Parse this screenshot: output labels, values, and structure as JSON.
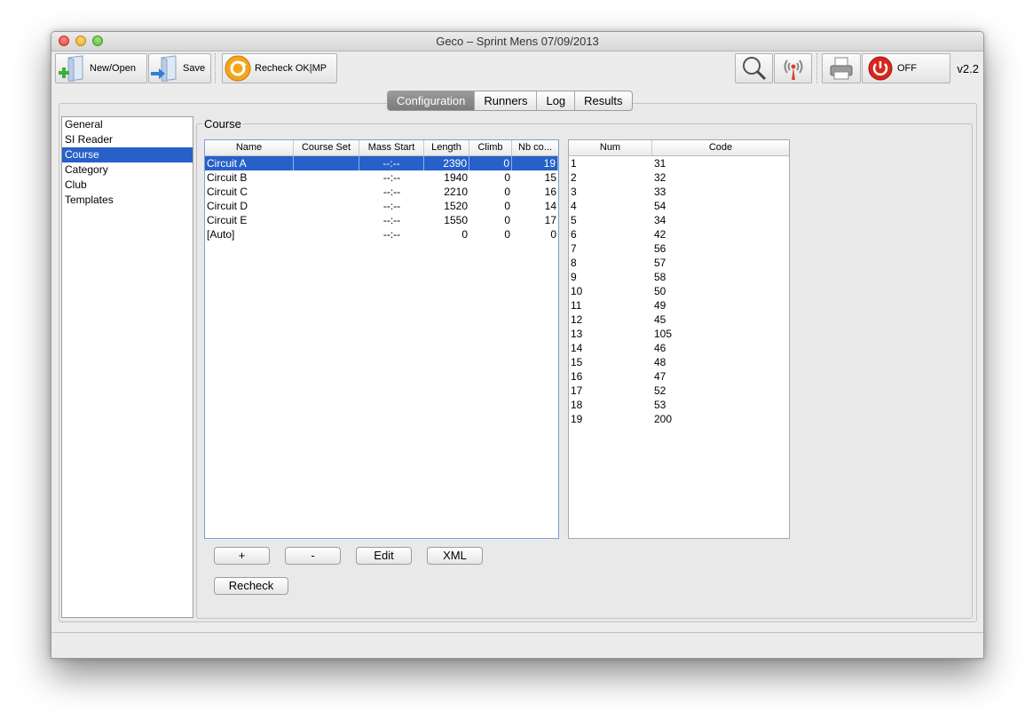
{
  "window": {
    "title": "Geco – Sprint Mens 07/09/2013"
  },
  "toolbar": {
    "new_open": "New/Open",
    "save": "Save",
    "recheck_ok_mp": "Recheck OK|MP",
    "off": "OFF",
    "version": "v2.2"
  },
  "tabs": [
    "Configuration",
    "Runners",
    "Log",
    "Results"
  ],
  "nav": [
    "General",
    "SI Reader",
    "Course",
    "Category",
    "Club",
    "Templates"
  ],
  "group_title": "Course",
  "courses_table": {
    "headers": [
      "Name",
      "Course Set",
      "Mass Start",
      "Length",
      "Climb",
      "Nb co..."
    ],
    "rows": [
      [
        "Circuit A",
        "",
        "--:--",
        "2390",
        "0",
        "19"
      ],
      [
        "Circuit B",
        "",
        "--:--",
        "1940",
        "0",
        "15"
      ],
      [
        "Circuit C",
        "",
        "--:--",
        "2210",
        "0",
        "16"
      ],
      [
        "Circuit D",
        "",
        "--:--",
        "1520",
        "0",
        "14"
      ],
      [
        "Circuit E",
        "",
        "--:--",
        "1550",
        "0",
        "17"
      ],
      [
        "[Auto]",
        "",
        "--:--",
        "0",
        "0",
        "0"
      ]
    ]
  },
  "controls_table": {
    "headers": [
      "Num",
      "Code"
    ],
    "rows": [
      [
        "1",
        "31"
      ],
      [
        "2",
        "32"
      ],
      [
        "3",
        "33"
      ],
      [
        "4",
        "54"
      ],
      [
        "5",
        "34"
      ],
      [
        "6",
        "42"
      ],
      [
        "7",
        "56"
      ],
      [
        "8",
        "57"
      ],
      [
        "9",
        "58"
      ],
      [
        "10",
        "50"
      ],
      [
        "11",
        "49"
      ],
      [
        "12",
        "45"
      ],
      [
        "13",
        "105"
      ],
      [
        "14",
        "46"
      ],
      [
        "15",
        "48"
      ],
      [
        "16",
        "47"
      ],
      [
        "17",
        "52"
      ],
      [
        "18",
        "53"
      ],
      [
        "19",
        "200"
      ]
    ]
  },
  "buttons": {
    "add": "+",
    "remove": "-",
    "edit": "Edit",
    "xml": "XML",
    "recheck": "Recheck"
  }
}
